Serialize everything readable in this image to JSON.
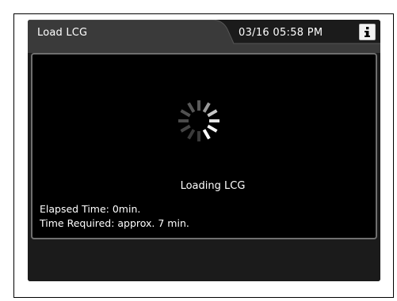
{
  "window": {
    "title": "Load LCG",
    "datetime": "03/16 05:58 PM",
    "info_icon": "info-icon"
  },
  "status": {
    "loading_text": "Loading LCG",
    "elapsed_label": "Elapsed Time: 0min.",
    "required_label": "Time Required: approx. 7 min."
  },
  "spinner": {
    "icon": "loading-spinner-icon",
    "color_bright": "#ffffff",
    "color_dim": "#5a5a5a"
  },
  "colors": {
    "background": "#1b1b1b",
    "panel": "#000000",
    "panel_border": "#6f6f6f",
    "text": "#ffffff"
  }
}
